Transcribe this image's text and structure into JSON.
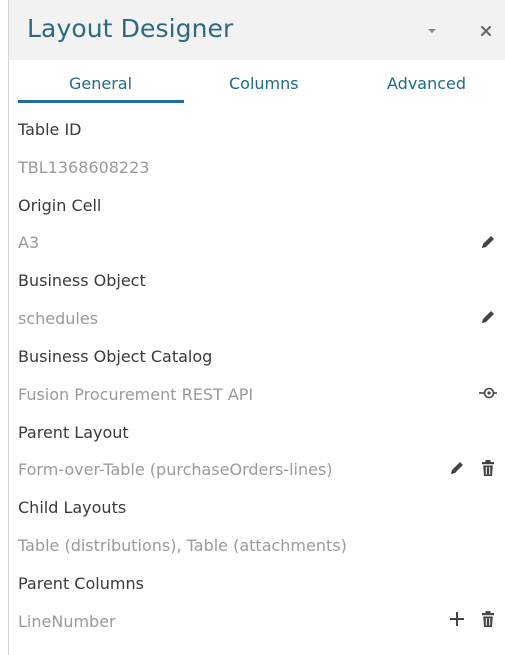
{
  "window": {
    "title": "Layout Designer",
    "menu_icon": "chevron-down-icon",
    "close_icon": "close-icon"
  },
  "tabs": [
    {
      "label": "General",
      "active": true
    },
    {
      "label": "Columns",
      "active": false
    },
    {
      "label": "Advanced",
      "active": false
    }
  ],
  "fields": {
    "table_id": {
      "label": "Table ID",
      "value": "TBL1368608223"
    },
    "origin_cell": {
      "label": "Origin Cell",
      "value": "A3"
    },
    "business_object": {
      "label": "Business Object",
      "value": "schedules"
    },
    "business_object_catalog": {
      "label": "Business Object Catalog",
      "value": "Fusion Procurement REST API"
    },
    "parent_layout": {
      "label": "Parent Layout",
      "value": "Form-over-Table (purchaseOrders-lines)"
    },
    "child_layouts": {
      "label": "Child Layouts",
      "value": "Table (distributions), Table (attachments)"
    },
    "parent_columns": {
      "label": "Parent Columns",
      "value": "LineNumber"
    }
  },
  "colors": {
    "title": "#2b6a82",
    "tab_text": "#1d6a86",
    "tab_underline": "#1e6e9e",
    "label": "#3a3a3a",
    "value": "#9a9a9a",
    "icon": "#444444"
  }
}
